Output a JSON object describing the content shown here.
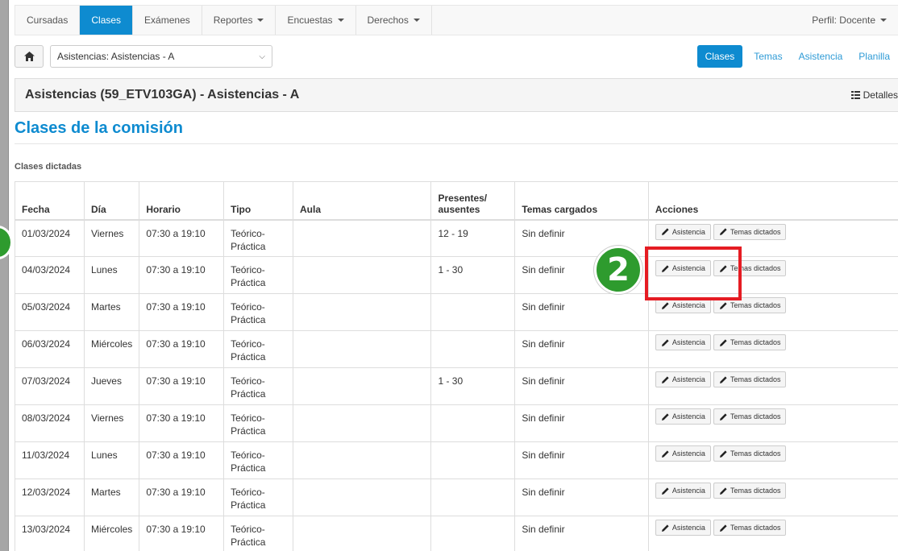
{
  "nav": {
    "items": [
      {
        "label": "Cursadas",
        "active": false,
        "dropdown": false
      },
      {
        "label": "Clases",
        "active": true,
        "dropdown": false
      },
      {
        "label": "Exámenes",
        "active": false,
        "dropdown": false
      },
      {
        "label": "Reportes",
        "active": false,
        "dropdown": true
      },
      {
        "label": "Encuestas",
        "active": false,
        "dropdown": true
      },
      {
        "label": "Derechos",
        "active": false,
        "dropdown": true
      }
    ],
    "profile_label": "Perfil: Docente",
    "active_color": "#0e8bd0"
  },
  "toolbar": {
    "home_icon": "home-icon",
    "select_value": "Asistencias: Asistencias - A",
    "tabs": [
      "Clases",
      "Temas",
      "Asistencia",
      "Planilla"
    ],
    "active_tab": "Clases"
  },
  "panel": {
    "title": "Asistencias (59_ETV103GA) - Asistencias - A",
    "details_label": "Detalles"
  },
  "section": {
    "title": "Clases de la comisión",
    "subtitle": "Clases dictadas"
  },
  "table": {
    "headers": {
      "fecha": "Fecha",
      "dia": "Día",
      "horario": "Horario",
      "tipo": "Tipo",
      "aula": "Aula",
      "presentes_1": "Presentes/",
      "presentes_2": "ausentes",
      "temas": "Temas cargados",
      "acciones": "Acciones"
    },
    "buttons": {
      "asistencia": "Asistencia",
      "temas": "Temas dictados"
    },
    "rows": [
      {
        "fecha": "01/03/2024",
        "dia": "Viernes",
        "horario": "07:30 a 19:10",
        "tipo_1": "Teórico-",
        "tipo_2": "Práctica",
        "aula": "",
        "presentes": "12 - 19",
        "temas": "Sin definir"
      },
      {
        "fecha": "04/03/2024",
        "dia": "Lunes",
        "horario": "07:30 a 19:10",
        "tipo_1": "Teórico-",
        "tipo_2": "Práctica",
        "aula": "",
        "presentes": "1 - 30",
        "temas": "Sin definir"
      },
      {
        "fecha": "05/03/2024",
        "dia": "Martes",
        "horario": "07:30 a 19:10",
        "tipo_1": "Teórico-",
        "tipo_2": "Práctica",
        "aula": "",
        "presentes": "",
        "temas": "Sin definir"
      },
      {
        "fecha": "06/03/2024",
        "dia": "Miércoles",
        "horario": "07:30 a 19:10",
        "tipo_1": "Teórico-",
        "tipo_2": "Práctica",
        "aula": "",
        "presentes": "",
        "temas": "Sin definir"
      },
      {
        "fecha": "07/03/2024",
        "dia": "Jueves",
        "horario": "07:30 a 19:10",
        "tipo_1": "Teórico-",
        "tipo_2": "Práctica",
        "aula": "",
        "presentes": "1 - 30",
        "temas": "Sin definir"
      },
      {
        "fecha": "08/03/2024",
        "dia": "Viernes",
        "horario": "07:30 a 19:10",
        "tipo_1": "Teórico-",
        "tipo_2": "Práctica",
        "aula": "",
        "presentes": "",
        "temas": "Sin definir"
      },
      {
        "fecha": "11/03/2024",
        "dia": "Lunes",
        "horario": "07:30 a 19:10",
        "tipo_1": "Teórico-",
        "tipo_2": "Práctica",
        "aula": "",
        "presentes": "",
        "temas": "Sin definir"
      },
      {
        "fecha": "12/03/2024",
        "dia": "Martes",
        "horario": "07:30 a 19:10",
        "tipo_1": "Teórico-",
        "tipo_2": "Práctica",
        "aula": "",
        "presentes": "",
        "temas": "Sin definir"
      },
      {
        "fecha": "13/03/2024",
        "dia": "Miércoles",
        "horario": "07:30 a 19:10",
        "tipo_1": "Teórico-",
        "tipo_2": "Práctica",
        "aula": "",
        "presentes": "",
        "temas": "Sin definir"
      }
    ]
  },
  "annotation": {
    "badge_number": "2",
    "badge_color": "#2e9b2e",
    "box_color": "#e51c23"
  }
}
